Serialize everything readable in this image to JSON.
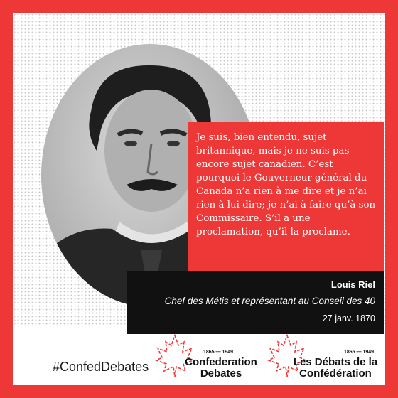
{
  "quote": {
    "text": "Je suis, bien entendu, sujet britannique, mais je ne suis pas encore sujet canadien. C’est pourquoi le Gouverneur général du Canada n’a rien à me dire et je n’ai rien à lui dire; je n’ai à faire qu’à son Commissaire. S’il a une proclamation, qu’il la proclame."
  },
  "attribution": {
    "name": "Louis Riel",
    "role": "Chef des Métis et représentant au Conseil des 40",
    "date": "27 janv. 1870"
  },
  "hashtag": "#ConfedDebates",
  "logos": {
    "english": {
      "years": "1865 — 1949",
      "line1": "Confederation",
      "line2": "Debates"
    },
    "french": {
      "years": "1865 — 1949",
      "line1": "Les Débats de la",
      "line2": "Confédération"
    }
  },
  "colors": {
    "accent": "#ee3838",
    "dark": "#111111",
    "background": "#ffffff"
  },
  "icons": [
    "portrait-photo",
    "maple-leaf-icon"
  ]
}
